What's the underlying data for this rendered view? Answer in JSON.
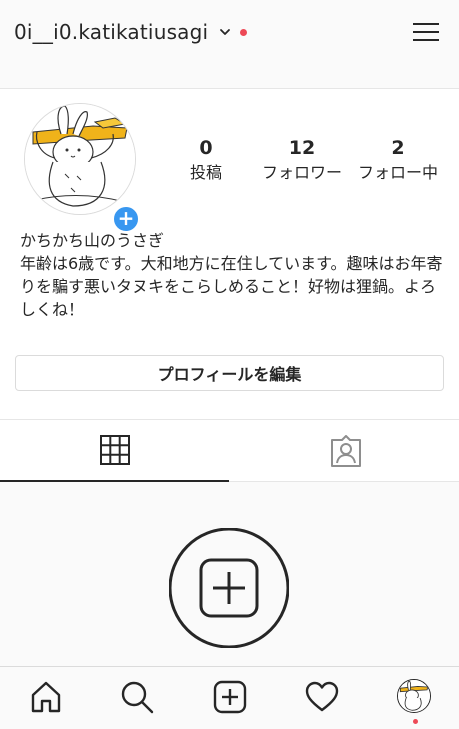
{
  "header": {
    "username": "0i__i0.katikatiusagi",
    "icons": {
      "dropdown": "chevron-down-icon",
      "menu": "hamburger-menu-icon"
    },
    "notification_dot_color": "#ed4956"
  },
  "profile": {
    "avatar_icon": "rabbit-avatar-image",
    "add_story_icon": "plus-icon",
    "add_story_label": "+",
    "stats": [
      {
        "value": "0",
        "label": "投稿"
      },
      {
        "value": "12",
        "label": "フォロワー"
      },
      {
        "value": "2",
        "label": "フォロー中"
      }
    ],
    "name": "かちかち山のうさぎ",
    "bio": "年齢は6歳です。大和地方に在住しています。趣味はお年寄りを騙す悪いタヌキをこらしめること！好物は狸鍋。よろしくね！",
    "edit_button": "プロフィールを編集"
  },
  "tabs": [
    {
      "icon": "grid-icon",
      "active": true
    },
    {
      "icon": "tagged-person-icon",
      "active": false
    }
  ],
  "empty_state": {
    "icon": "add-post-circle-icon"
  },
  "bottom_nav": [
    {
      "icon": "home-icon"
    },
    {
      "icon": "search-icon"
    },
    {
      "icon": "new-post-icon"
    },
    {
      "icon": "heart-icon"
    },
    {
      "icon": "profile-avatar-icon"
    }
  ],
  "colors": {
    "accent": "#3897f0",
    "text": "#262626",
    "border": "#dbdbdb",
    "background": "#fafafa",
    "notification": "#ed4956"
  }
}
